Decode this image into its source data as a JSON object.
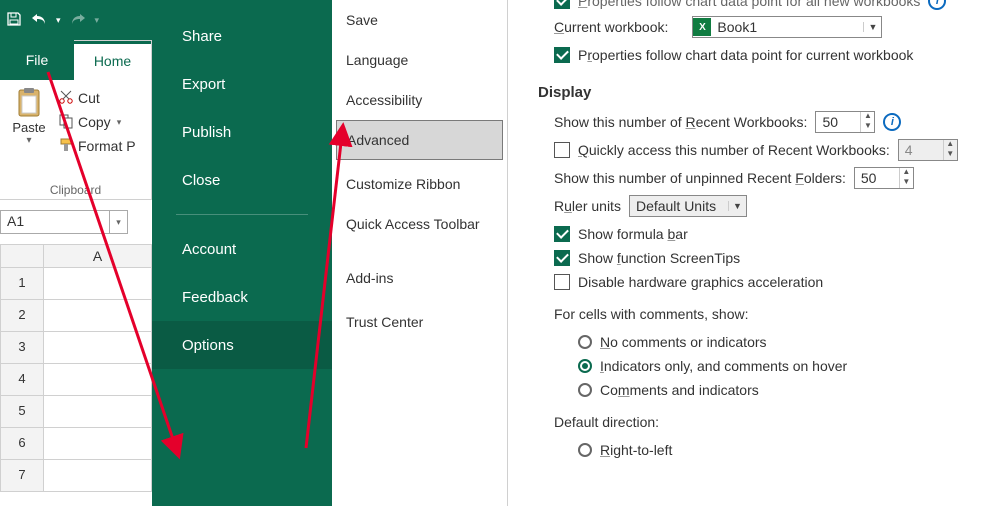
{
  "qat": {
    "save": "save",
    "undo": "undo",
    "redo": "redo"
  },
  "tabs": {
    "file": "File",
    "home": "Home"
  },
  "clipboard": {
    "paste": "Paste",
    "cut": "Cut",
    "copy": "Copy",
    "format": "Format P",
    "group_label": "Clipboard"
  },
  "namebox": {
    "value": "A1"
  },
  "sheet": {
    "col": "A",
    "rows": [
      "1",
      "2",
      "3",
      "4",
      "5",
      "6",
      "7"
    ]
  },
  "backstage": {
    "items": [
      "Share",
      "Export",
      "Publish",
      "Close"
    ],
    "lower": [
      "Account",
      "Feedback",
      "Options"
    ],
    "selected": "Options"
  },
  "categories": {
    "items": [
      "Save",
      "Language",
      "Accessibility",
      "Advanced",
      "Customize Ribbon",
      "Quick Access Toolbar",
      "Add-ins",
      "Trust Center"
    ],
    "selected": "Advanced"
  },
  "details": {
    "topcut_label": "Properties follow chart data point for all new workbooks",
    "current_workbook_label": "Current workbook:",
    "current_workbook_value": "Book1",
    "prop_follow_current": "Properties follow chart data point for current workbook",
    "display_header": "Display",
    "recent_wb_label": "Show this number of Recent Workbooks:",
    "recent_wb_value": "50",
    "quick_access_label": "Quickly access this number of Recent Workbooks:",
    "quick_access_value": "4",
    "recent_folders_label": "Show this number of unpinned Recent Folders:",
    "recent_folders_value": "50",
    "ruler_label": "Ruler units",
    "ruler_value": "Default Units",
    "show_formula_bar": "Show formula bar",
    "show_screentips": "Show function ScreenTips",
    "disable_hw": "Disable hardware graphics acceleration",
    "comments_header": "For cells with comments, show:",
    "comments_opts": [
      "No comments or indicators",
      "Indicators only, and comments on hover",
      "Comments and indicators"
    ],
    "dir_header": "Default direction:",
    "dir_opts": [
      "Right-to-left"
    ]
  }
}
